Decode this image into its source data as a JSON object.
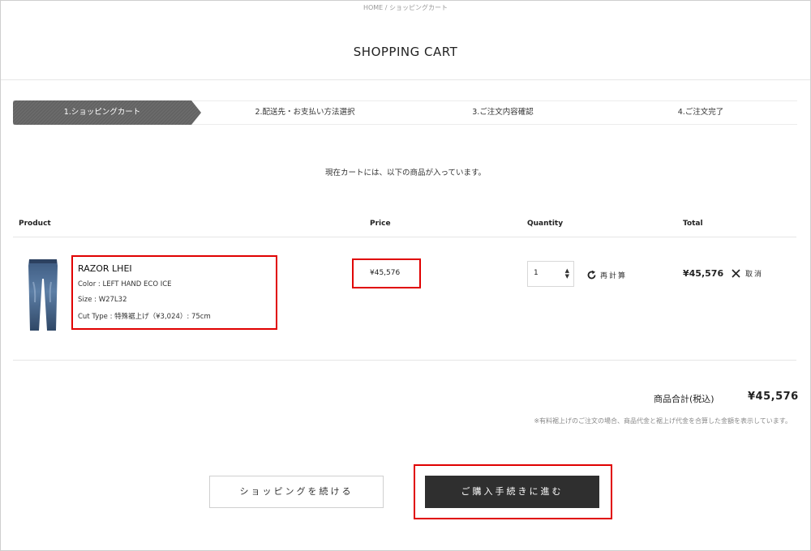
{
  "breadcrumb": "HOME / ショッピングカート",
  "page_title": "SHOPPING CART",
  "steps": [
    {
      "label": "1.ショッピングカート",
      "active": true
    },
    {
      "label": "2.配送先・お支払い方法選択",
      "active": false
    },
    {
      "label": "3.ご注文内容確認",
      "active": false
    },
    {
      "label": "4.ご注文完了",
      "active": false
    }
  ],
  "intro_text": "現在カートには、以下の商品が入っています。",
  "table": {
    "headers": {
      "product": "Product",
      "price": "Price",
      "quantity": "Quantity",
      "total": "Total"
    },
    "rows": [
      {
        "name": "RAZOR LHEI",
        "color": "Color : LEFT HAND ECO ICE",
        "size": "Size : W27L32",
        "cut_type": "Cut Type : 特殊裾上げ（¥3,024）: 75cm",
        "price": "¥45,576",
        "quantity": "1",
        "recalc_label": "再計算",
        "total": "¥45,576",
        "remove_label": "取消"
      }
    ]
  },
  "summary": {
    "label": "商品合計(税込)",
    "value": "¥45,576",
    "note": "※有料裾上げのご注文の場合、商品代金と裾上げ代金を合算した金額を表示しています。"
  },
  "buttons": {
    "continue_shopping": "ショッピングを続ける",
    "checkout": "ご購入手続きに進む"
  },
  "icons": {
    "product_thumbnail": "jeans-image",
    "recalc": "refresh-icon",
    "remove": "close-icon",
    "quantity": "select-arrows-icon"
  },
  "colors": {
    "active_step": "#6b6b6b",
    "checkout_button": "#2f2f2f",
    "highlight": "#e00000"
  }
}
